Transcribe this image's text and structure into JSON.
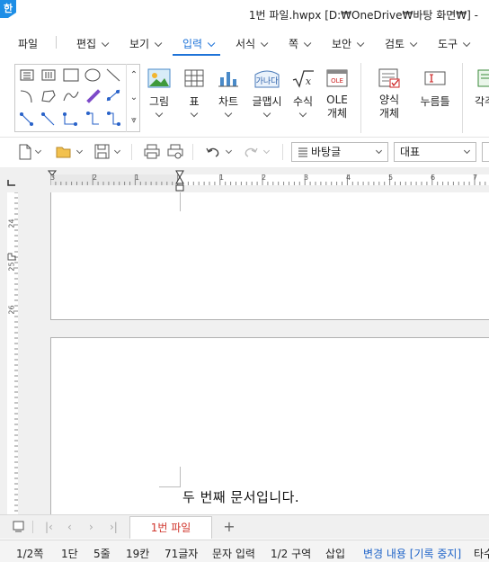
{
  "app": {
    "logo": "한",
    "title": "1번 파일.hwpx [D:₩OneDrive₩바탕 화면₩] -"
  },
  "menu": {
    "file": "파일",
    "items": [
      {
        "label": "편집"
      },
      {
        "label": "보기"
      },
      {
        "label": "입력",
        "active": true
      },
      {
        "label": "서식"
      },
      {
        "label": "쪽"
      },
      {
        "label": "보안"
      },
      {
        "label": "검토"
      },
      {
        "label": "도구"
      }
    ]
  },
  "ribbon": {
    "picture": "그림",
    "table": "표",
    "chart": "차트",
    "wordart": "글맵시",
    "wordart_sample": "가나다",
    "formula": "수식",
    "ole_line1": "OLE",
    "ole_line2": "개체",
    "ole_icon_text": "OLE",
    "form_line1": "양식",
    "form_line2": "개체",
    "click_field": "누름틀",
    "more": "각주"
  },
  "toolbar": {
    "style_value": "바탕글",
    "font_value": "대표"
  },
  "ruler": {
    "h_labels": [
      "3",
      "2",
      "1",
      "1",
      "2",
      "3",
      "4",
      "5",
      "6",
      "7"
    ],
    "v_labels": [
      "24",
      "25",
      "26"
    ]
  },
  "document": {
    "page2_text": "두 번째 문서입니다."
  },
  "tabs": {
    "active_tab": "1번 파일",
    "add": "+"
  },
  "status": {
    "page": "1/2쪽",
    "column": "1단",
    "line": "5줄",
    "col": "19칸",
    "chars": "71글자",
    "mode": "문자 입력",
    "section": "1/2 구역",
    "insert": "삽입",
    "track": "변경 내용 [기록 중지]",
    "more": "타수"
  },
  "colors": {
    "accent": "#1e73d8",
    "tab_text": "#d0372e",
    "status_blue": "#1e63c8"
  }
}
